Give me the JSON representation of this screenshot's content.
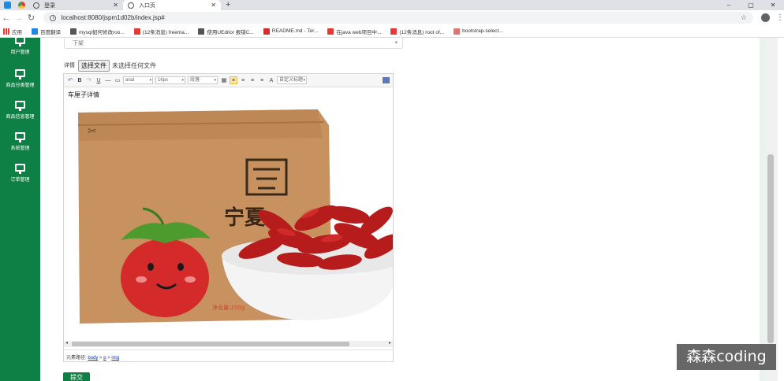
{
  "browser": {
    "tabs": [
      {
        "label": "登录"
      },
      {
        "label": "入口页"
      }
    ],
    "new_tab": "+",
    "window": {
      "minimize": "–",
      "maximize": "▢",
      "close": "✕"
    },
    "url": "localhost:8080/jspm1d02b/index.jsp#",
    "bookmarks": [
      {
        "label": "应用",
        "color": "#e53935"
      },
      {
        "label": "百度翻译",
        "color": "#1e88e5"
      },
      {
        "label": "mysql如何修改roo...",
        "color": "#555555"
      },
      {
        "label": "(12条消息) freema...",
        "color": "#e53935"
      },
      {
        "label": "使用UEditor 报错C...",
        "color": "#555555"
      },
      {
        "label": "README.md - Ter...",
        "color": "#d32f2f"
      },
      {
        "label": "在java web项目中...",
        "color": "#e53935"
      },
      {
        "label": "(12条消息) root of...",
        "color": "#e53935"
      },
      {
        "label": "bootstrap-select...",
        "color": "#e57373"
      }
    ]
  },
  "sidebar": {
    "items": [
      {
        "label": "用户管理"
      },
      {
        "label": "商品分类管理"
      },
      {
        "label": "商品信息管理"
      },
      {
        "label": "系统管理"
      },
      {
        "label": "订单管理"
      }
    ]
  },
  "form": {
    "select_value": "下架",
    "detail_label": "详情",
    "file_button": "选择文件",
    "file_status": "未选择任何文件",
    "submit_label": "提交"
  },
  "editor": {
    "font_family": "arial",
    "font_size": "16px",
    "paragraph": "段落",
    "custom_title": "自定义标题",
    "content_text": "车厘子详情",
    "element_path_label": "元素路径:",
    "element_path": [
      "body",
      "p",
      "img"
    ]
  },
  "product_image": {
    "brand_text": "宁夏",
    "weight_text": "净含量:250g"
  },
  "watermark": "森森coding",
  "colors": {
    "sidebar": "#0f8045",
    "bag": "#c8915c",
    "berry": "#c62828"
  }
}
